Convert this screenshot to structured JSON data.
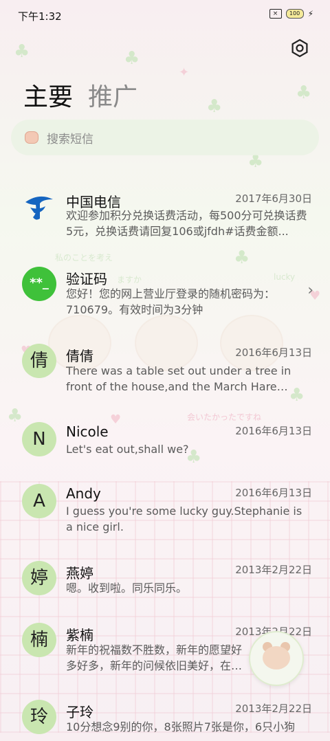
{
  "status": {
    "time": "下午1:32",
    "sim_label": "×",
    "battery": "100"
  },
  "tabs": [
    {
      "label": "主要"
    },
    {
      "label": "推广"
    }
  ],
  "search": {
    "placeholder": "搜索短信"
  },
  "messages": [
    {
      "avatar": "",
      "name": "中国电信",
      "date": "2017年6月30日",
      "preview": "欢迎参加积分兑换话费活动，每500分可兑换话费5元，兑换话费请回复106或jfdh#话费金额..."
    },
    {
      "avatar": "**_",
      "name": "验证码",
      "date": "",
      "preview": "您好！您的网上营业厅登录的随机密码为：710679。有效时间为3分钟"
    },
    {
      "avatar": "倩",
      "name": "倩倩",
      "date": "2016年6月13日",
      "preview": "There was a table set out under a tree in front of the house,and the March Hare and..."
    },
    {
      "avatar": "N",
      "name": "Nicole",
      "date": "2016年6月13日",
      "preview": "Let's eat out,shall we?"
    },
    {
      "avatar": "A",
      "name": "Andy",
      "date": "2016年6月13日",
      "preview": "I guess you're some lucky guy.Stephanie is a nice girl."
    },
    {
      "avatar": "婷",
      "name": "燕婷",
      "date": "2013年2月22日",
      "preview": "嗯。收到啦。同乐同乐。"
    },
    {
      "avatar": "楠",
      "name": "紫楠",
      "date": "2013年2月22日",
      "preview": "新年的祝福数不胜数，新年的愿望好多好多，新年的问候依旧美好，在这个温馨的..."
    },
    {
      "avatar": "玲",
      "name": "子玲",
      "date": "2013年2月22日",
      "preview": "10分想念9别的你，8张照片7张是你，6只小狗"
    }
  ],
  "deco": {
    "line1": "私のことを考え",
    "line2": "ますか",
    "line3": "lucky",
    "line4": "会いたかったですね"
  },
  "colors": {
    "accent_green": "#3fc13a",
    "avatar_bg": "#c9e6b0",
    "telecom_blue": "#1565c0"
  }
}
